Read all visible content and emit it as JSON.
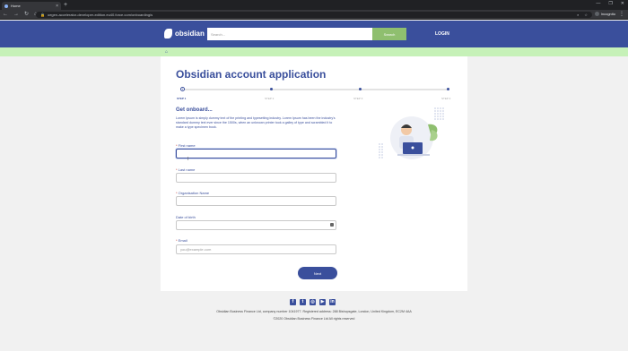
{
  "browser": {
    "tab_title": "Home",
    "new_tab": "+",
    "url": "oegen-accelerator-developer-edition.eu40.force.com/onboarding/s",
    "profile": "Incognito",
    "window_controls": [
      "—",
      "❐",
      "✕"
    ]
  },
  "header": {
    "logo_text": "obsidian",
    "search_placeholder": "Search...",
    "search_button": "Search",
    "login": "LOGIN"
  },
  "form": {
    "title": "Obsidian account application",
    "steps": [
      "STEP 1",
      "STEP 2",
      "STEP 3",
      "STEP 4"
    ],
    "subtitle": "Get onboard...",
    "intro": "Lorem Ipsum is simply dummy text of the printing and typesetting industry. Lorem Ipsum has been the industry's standard dummy text ever since the 1500s, when an unknown printer took a galley of type and scrambled it to make a type specimen book.",
    "fields": [
      {
        "label": "First name",
        "required": true,
        "placeholder": ""
      },
      {
        "label": "Last name",
        "required": true,
        "placeholder": ""
      },
      {
        "label": "Organisation Name",
        "required": true,
        "placeholder": ""
      },
      {
        "label": "Date of birth",
        "required": false,
        "placeholder": ""
      },
      {
        "label": "Email",
        "required": true,
        "placeholder": "you@example.com"
      }
    ],
    "next_button": "Next"
  },
  "footer": {
    "socials": [
      "facebook-icon",
      "twitter-icon",
      "instagram-icon",
      "youtube-icon",
      "linkedin-icon"
    ],
    "company": "Obsidian Business Finance Ltd, company number 1041977. Registered address: 288 Bishopsgate, London, United Kingdom, EC2M 4AA",
    "copyright": "©2020 Obsidian Business Finance Ltd All rights reserved"
  },
  "colors": {
    "brand": "#3a4f9c",
    "accent_green": "#8fbf6f",
    "banner_green": "#c6f1b8"
  }
}
